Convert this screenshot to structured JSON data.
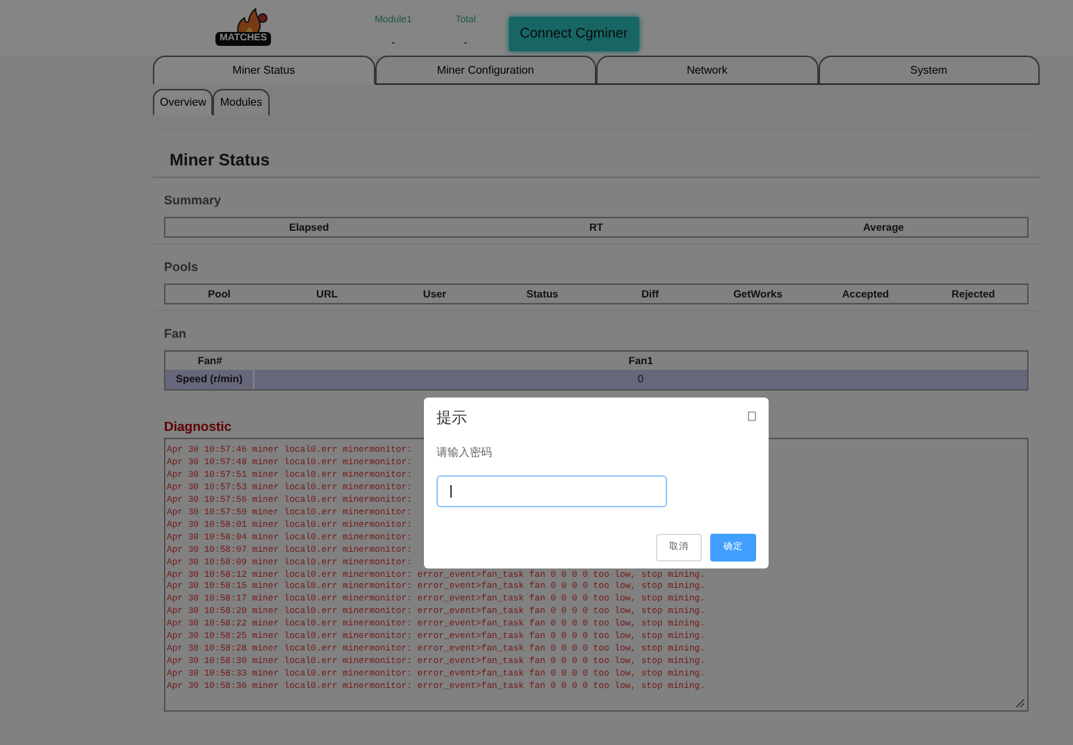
{
  "header": {
    "logo_text": "MATCHES",
    "stats": [
      {
        "label": "Module1",
        "value": "-"
      },
      {
        "label": "Total",
        "value": "-"
      }
    ],
    "connect_button": "Connect Cgminer"
  },
  "tabs": [
    {
      "label": "Miner Status",
      "selected": true
    },
    {
      "label": "Miner Configuration",
      "selected": false
    },
    {
      "label": "Network",
      "selected": false
    },
    {
      "label": "System",
      "selected": false
    }
  ],
  "subtabs": [
    {
      "label": "Overview",
      "selected": true
    },
    {
      "label": "Modules",
      "selected": false
    }
  ],
  "panel": {
    "title": "Miner Status",
    "summary": {
      "heading": "Summary",
      "columns": [
        "Elapsed",
        "RT",
        "Average"
      ]
    },
    "pools": {
      "heading": "Pools",
      "columns": [
        "Pool",
        "URL",
        "User",
        "Status",
        "Diff",
        "GetWorks",
        "Accepted",
        "Rejected"
      ]
    },
    "fan": {
      "heading": "Fan",
      "header": [
        "Fan#",
        "Fan1"
      ],
      "row": [
        "Speed (r/min)",
        "0"
      ]
    },
    "diagnostic": {
      "heading": "Diagnostic",
      "lines": [
        "Apr 30 10:57:46 miner local0.err minermonitor:",
        "Apr 30 10:57:48 miner local0.err minermonitor:",
        "Apr 30 10:57:51 miner local0.err minermonitor:",
        "Apr 30 10:57:53 miner local0.err minermonitor:",
        "Apr 30 10:57:56 miner local0.err minermonitor:",
        "Apr 30 10:57:59 miner local0.err minermonitor:",
        "Apr 30 10:58:01 miner local0.err minermonitor:",
        "Apr 30 10:58:04 miner local0.err minermonitor:",
        "Apr 30 10:58:07 miner local0.err minermonitor:",
        "Apr 30 10:58:09 miner local0.err minermonitor:",
        "Apr 30 10:58:12 miner local0.err minermonitor: error_event>fan_task fan 0 0 0 0 too low, stop mining.",
        "Apr 30 10:58:15 miner local0.err minermonitor: error_event>fan_task fan 0 0 0 0 too low, stop mining.",
        "Apr 30 10:58:17 miner local0.err minermonitor: error_event>fan_task fan 0 0 0 0 too low, stop mining.",
        "Apr 30 10:58:20 miner local0.err minermonitor: error_event>fan_task fan 0 0 0 0 too low, stop mining.",
        "Apr 30 10:58:22 miner local0.err minermonitor: error_event>fan_task fan 0 0 0 0 too low, stop mining.",
        "Apr 30 10:58:25 miner local0.err minermonitor: error_event>fan_task fan 0 0 0 0 too low, stop mining.",
        "Apr 30 10:58:28 miner local0.err minermonitor: error_event>fan_task fan 0 0 0 0 too low, stop mining.",
        "Apr 30 10:58:30 miner local0.err minermonitor: error_event>fan_task fan 0 0 0 0 too low, stop mining.",
        "Apr 30 10:58:33 miner local0.err minermonitor: error_event>fan_task fan 0 0 0 0 too low, stop mining.",
        "Apr 30 10:58:36 miner local0.err minermonitor: error_event>fan_task fan 0 0 0 0 too low, stop mining."
      ]
    }
  },
  "dialog": {
    "title": "提示",
    "message": "请输入密码",
    "buttons": [
      {
        "label": "取消",
        "kind": "secondary"
      },
      {
        "label": "确定",
        "kind": "primary"
      }
    ]
  }
}
